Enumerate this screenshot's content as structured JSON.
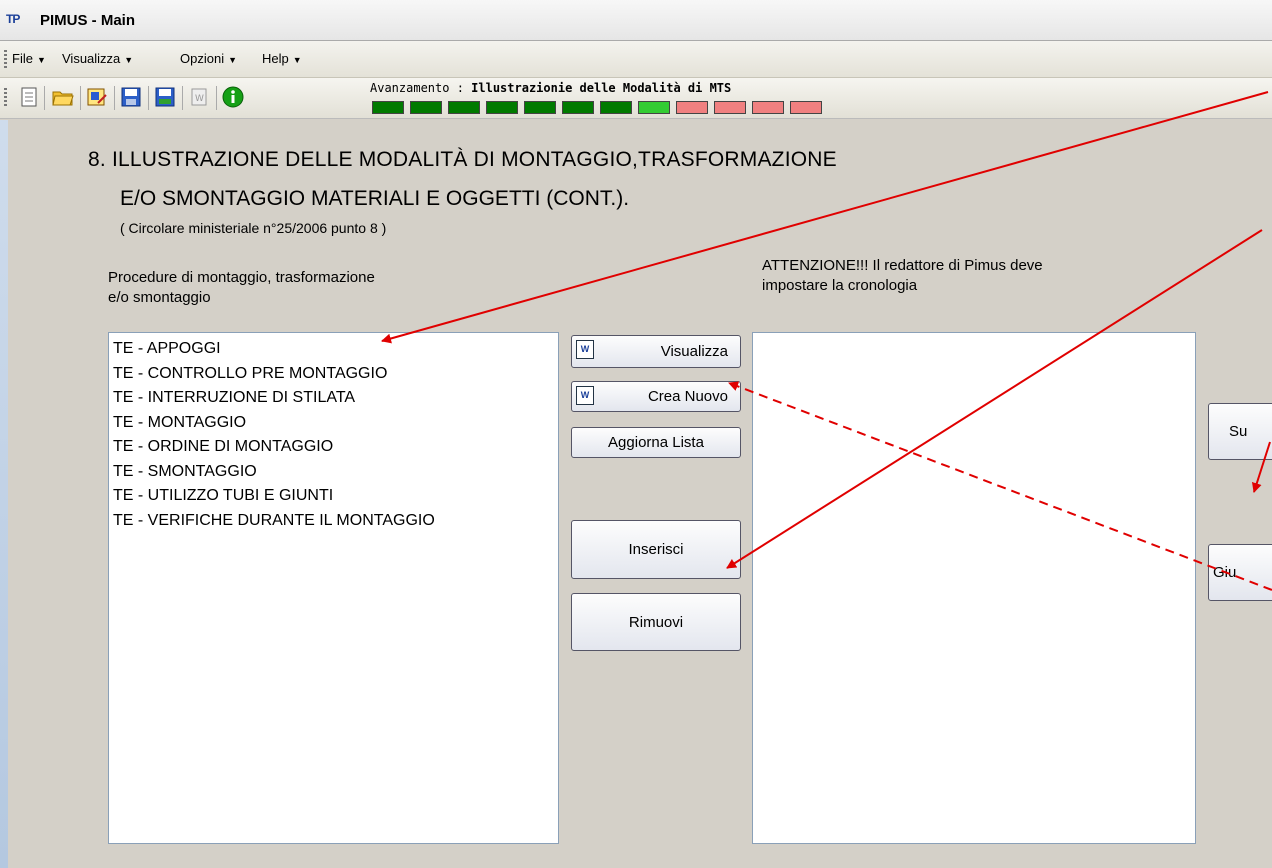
{
  "window": {
    "title": "PIMUS - Main",
    "logo_text": "TP"
  },
  "menu": [
    {
      "label": "File"
    },
    {
      "label": "Visualizza"
    },
    {
      "label": "Opzioni"
    },
    {
      "label": "Help"
    }
  ],
  "toolbar": {
    "icons": [
      "new-document-icon",
      "open-folder-icon",
      "edit-document-icon",
      "save-icon",
      "save-as-icon",
      "word-document-icon",
      "info-icon"
    ]
  },
  "progress": {
    "label": "Avanzamento : ",
    "step_name": "Illustrazionie delle Modalità di MTS",
    "steps": [
      "done",
      "done",
      "done",
      "done",
      "done",
      "done",
      "done",
      "current",
      "todo",
      "todo",
      "todo",
      "todo"
    ],
    "colors": {
      "done": "#007a00",
      "current": "#33cc33",
      "todo": "#f08080"
    }
  },
  "heading": {
    "line1": "8.  ILLUSTRAZIONE DELLE MODALITÀ DI MONTAGGIO,TRASFORMAZIONE",
    "line2": "E/O SMONTAGGIO MATERIALI E OGGETTI (CONT.).",
    "line3": "( Circolare ministeriale n°25/2006 punto 8 )"
  },
  "left_panel": {
    "label_line1": "Procedure di montaggio, trasformazione",
    "label_line2": "e/o smontaggio",
    "items": [
      "TE - APPOGGI",
      "TE - CONTROLLO PRE MONTAGGIO",
      "TE - INTERRUZIONE DI STILATA",
      "TE - MONTAGGIO",
      "TE - ORDINE DI MONTAGGIO",
      "TE - SMONTAGGIO",
      "TE - UTILIZZO TUBI E GIUNTI",
      "TE - VERIFICHE DURANTE IL MONTAGGIO"
    ]
  },
  "right_panel": {
    "label_line1": "ATTENZIONE!!! Il redattore di Pimus deve",
    "label_line2": "impostare la cronologia",
    "items": []
  },
  "buttons": {
    "visualizza": "Visualizza",
    "crea_nuovo": "Crea Nuovo",
    "aggiorna_lista": "Aggiorna Lista",
    "inserisci": "Inserisci",
    "rimuovi": "Rimuovi",
    "su": "Su",
    "giu": "Giu",
    "word_icon_text": "W"
  },
  "colors": {
    "annotation_arrow": "#e00000",
    "background": "#d4d0c8"
  }
}
